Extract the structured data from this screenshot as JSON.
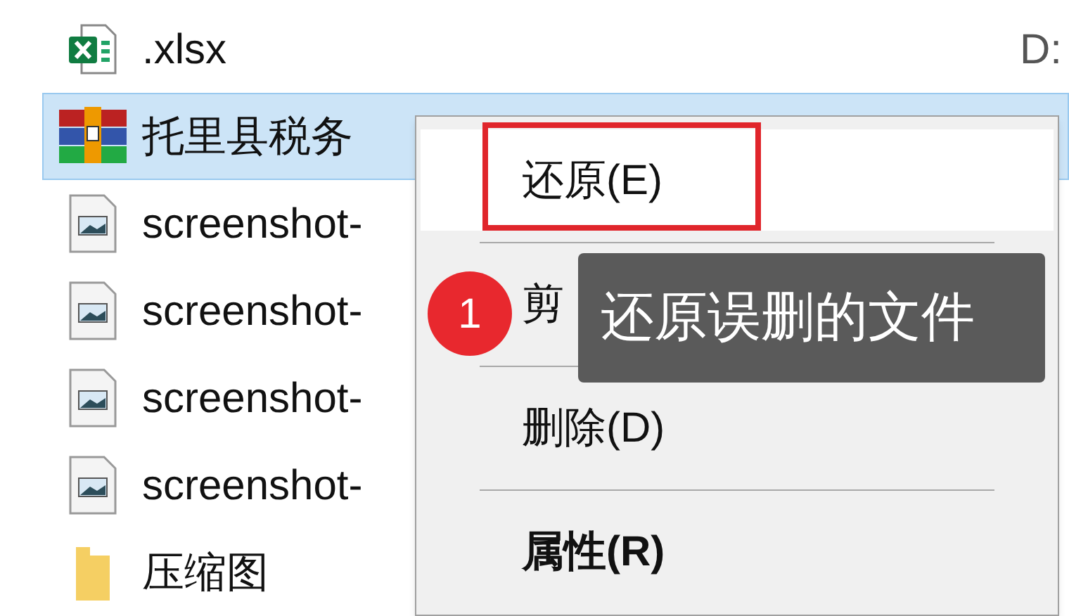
{
  "files": [
    {
      "name": ".xlsx",
      "kind": "excel",
      "selected": false,
      "location": "D:"
    },
    {
      "name": "托里县税务",
      "kind": "archive",
      "selected": true
    },
    {
      "name": "screenshot-",
      "kind": "image",
      "selected": false
    },
    {
      "name": "screenshot-",
      "kind": "image",
      "selected": false
    },
    {
      "name": "screenshot-",
      "kind": "image",
      "selected": false
    },
    {
      "name": "screenshot-",
      "kind": "image",
      "selected": false
    },
    {
      "name": "压缩图",
      "kind": "folder",
      "selected": false
    }
  ],
  "context_menu": {
    "items": [
      {
        "label": "还原(E)",
        "hovered": true,
        "highlighted": true,
        "default": false
      },
      {
        "label": "剪",
        "hovered": false,
        "highlighted": false,
        "default": false
      },
      {
        "label": "删除(D)",
        "hovered": false,
        "highlighted": false,
        "default": false
      },
      {
        "label": "属性(R)",
        "hovered": false,
        "highlighted": false,
        "default": true
      }
    ]
  },
  "annotation": {
    "badge": "1",
    "tooltip": "还原误删的文件"
  }
}
